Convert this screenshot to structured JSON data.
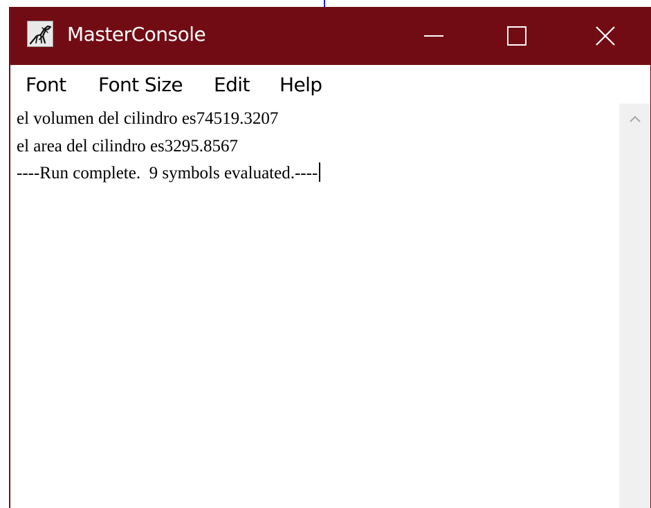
{
  "window": {
    "title": "MasterConsole",
    "icon": "dinosaur-skeleton-icon",
    "title_bar_color": "#720c14"
  },
  "titlebar_buttons": {
    "minimize": "minimize-icon",
    "maximize": "maximize-icon",
    "close": "close-icon"
  },
  "menu": {
    "items": [
      "Font",
      "Font Size",
      "Edit",
      "Help"
    ]
  },
  "console": {
    "lines": [
      "el volumen del cilindro es74519.3207",
      "el area del cilindro es3295.8567",
      "----Run complete.  9 symbols evaluated.----"
    ]
  },
  "scrollbar": {
    "up_arrow": "chevron-up-icon"
  }
}
